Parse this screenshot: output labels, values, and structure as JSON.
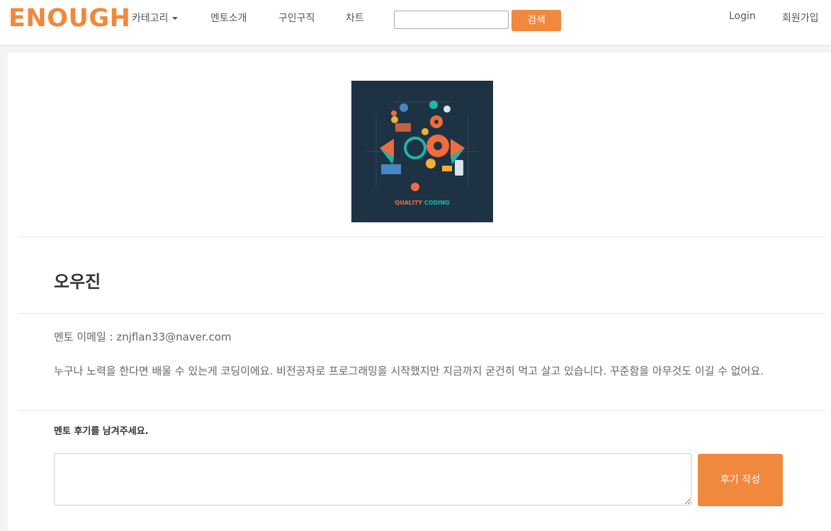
{
  "brand": "ENOUGH",
  "nav": {
    "category": "카테고리",
    "mentor_intro": "멘토소개",
    "jobs": "구인구직",
    "chart": "차트",
    "search_placeholder": "",
    "search_button": "검색",
    "login": "Login",
    "signup": "회원가입"
  },
  "mentor": {
    "image_caption_a": "QUALITY",
    "image_caption_b": "CODING",
    "name": "오우진",
    "email_label": "멘토 이메일 :",
    "email": "znjflan33@naver.com",
    "intro": "누구나 노력을 한다면 배울 수 있는게 코딩이에요. 비전공자로 프로그래밍을 시작했지만 지금까지 굳건히 먹고 살고 있습니다. 꾸준함을 아무것도 이길 수 없어요."
  },
  "review": {
    "label": "멘토 후기를 남겨주세요.",
    "textarea_value": "",
    "submit_button": "후기 작성"
  },
  "colors": {
    "accent": "#f0883d",
    "image_bg": "#1d3344"
  }
}
